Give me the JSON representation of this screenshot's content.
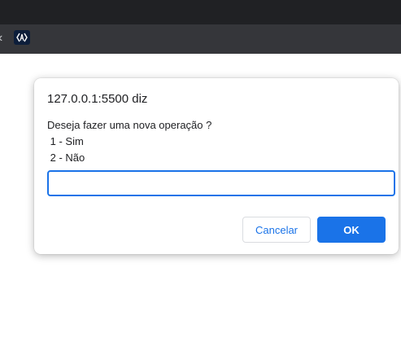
{
  "dialog": {
    "title": "127.0.0.1:5500 diz",
    "message_lines": [
      "Deseja fazer uma nova operação ?",
      " 1 - Sim",
      " 2 - Não"
    ],
    "input_value": "",
    "cancel_label": "Cancelar",
    "ok_label": "OK"
  },
  "colors": {
    "accent": "#1a73e8",
    "toolbar": "#35363a",
    "titlebar": "#202124"
  },
  "icons": {
    "toolbar_left": "back-arrow-icon",
    "favicon": "favicon-icon"
  }
}
